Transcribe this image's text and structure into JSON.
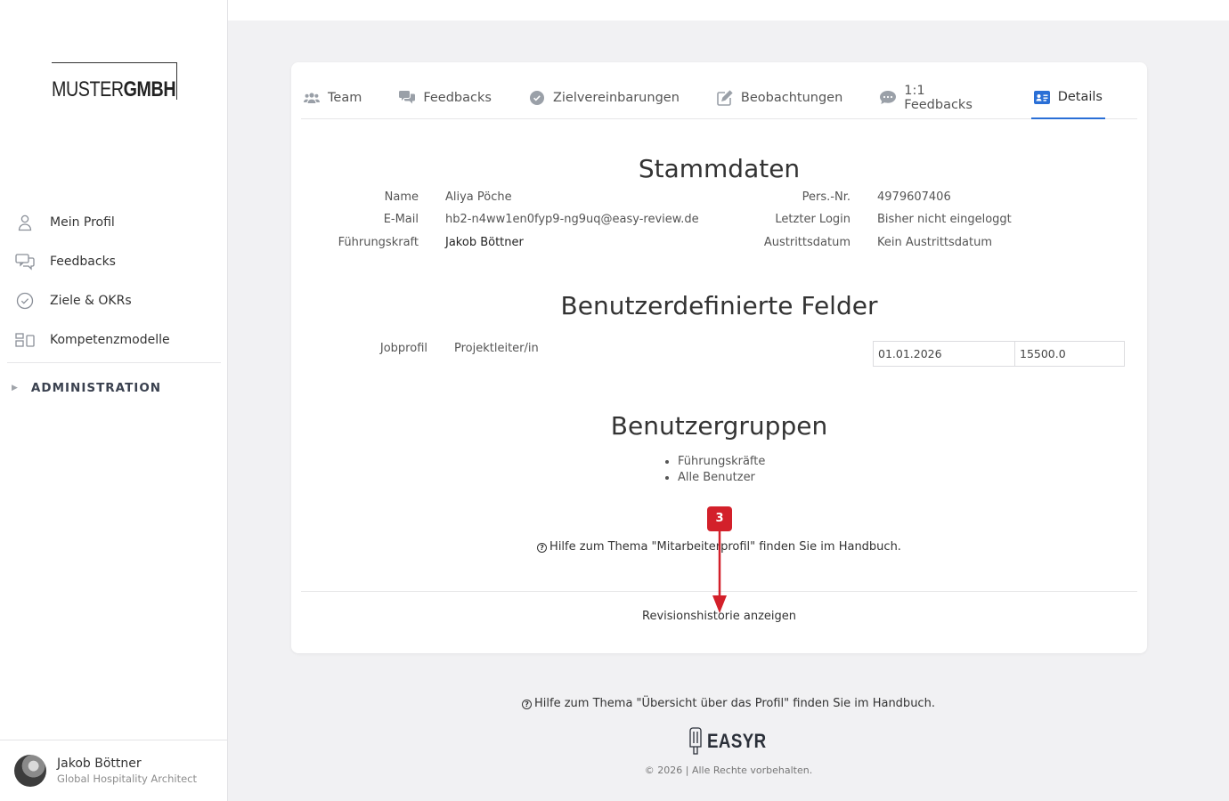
{
  "brand": {
    "logo_light": "MUSTER",
    "logo_bold": "GMBH"
  },
  "sidebar": {
    "items": [
      {
        "label": "Mein Profil",
        "icon": "person-icon"
      },
      {
        "label": "Feedbacks",
        "icon": "chat-bubbles-icon"
      },
      {
        "label": "Ziele & OKRs",
        "icon": "check-circle-icon"
      },
      {
        "label": "Kompetenzmodelle",
        "icon": "model-blocks-icon"
      }
    ],
    "admin_label": "ADMINISTRATION"
  },
  "user": {
    "name": "Jakob Böttner",
    "role": "Global Hospitality Architect"
  },
  "tabs": [
    {
      "label": "Team",
      "icon": "team-icon"
    },
    {
      "label": "Feedbacks",
      "icon": "chat-icon"
    },
    {
      "label": "Zielvereinbarungen",
      "icon": "check-circle-icon"
    },
    {
      "label": "Beobachtungen",
      "icon": "edit-icon"
    },
    {
      "label": "1:1 Feedbacks",
      "icon": "comment-dots-icon"
    },
    {
      "label": "Details",
      "icon": "id-card-icon",
      "active": true
    }
  ],
  "stammdaten": {
    "title": "Stammdaten",
    "left": [
      {
        "key": "Name",
        "value": "Aliya Pöche"
      },
      {
        "key": "E-Mail",
        "value": "hb2-n4ww1en0fyp9-ng9uq@easy-review.de"
      },
      {
        "key": "Führungskraft",
        "value": "Jakob Böttner"
      }
    ],
    "right": [
      {
        "key": "Pers.-Nr.",
        "value": "4979607406"
      },
      {
        "key": "Letzter Login",
        "value": "Bisher nicht eingeloggt"
      },
      {
        "key": "Austrittsdatum",
        "value": "Kein Austrittsdatum"
      }
    ]
  },
  "custom_fields": {
    "title": "Benutzerdefinierte Felder",
    "jobprofil_label": "Jobprofil",
    "jobprofil_value": "Projektleiter/in",
    "date_value": "01.01.2026",
    "amount_value": "15500.0"
  },
  "groups": {
    "title": "Benutzergruppen",
    "items": [
      "Führungskräfte",
      "Alle Benutzer"
    ]
  },
  "help_card": "Hilfe zum Thema \"Mitarbeiterprofil\" finden Sie im Handbuch.",
  "revision_link": "Revisionshistorie anzeigen",
  "annotation": {
    "number": "3",
    "color": "#d3202a"
  },
  "footer": {
    "help": "Hilfe zum Thema \"Übersicht über das Profil\" finden Sie im Handbuch.",
    "brand": "EASYR",
    "copyright": "© 2026 | Alle Rechte vorbehalten."
  },
  "colors": {
    "accent": "#2a6fd6",
    "background": "#f1f1f3"
  }
}
